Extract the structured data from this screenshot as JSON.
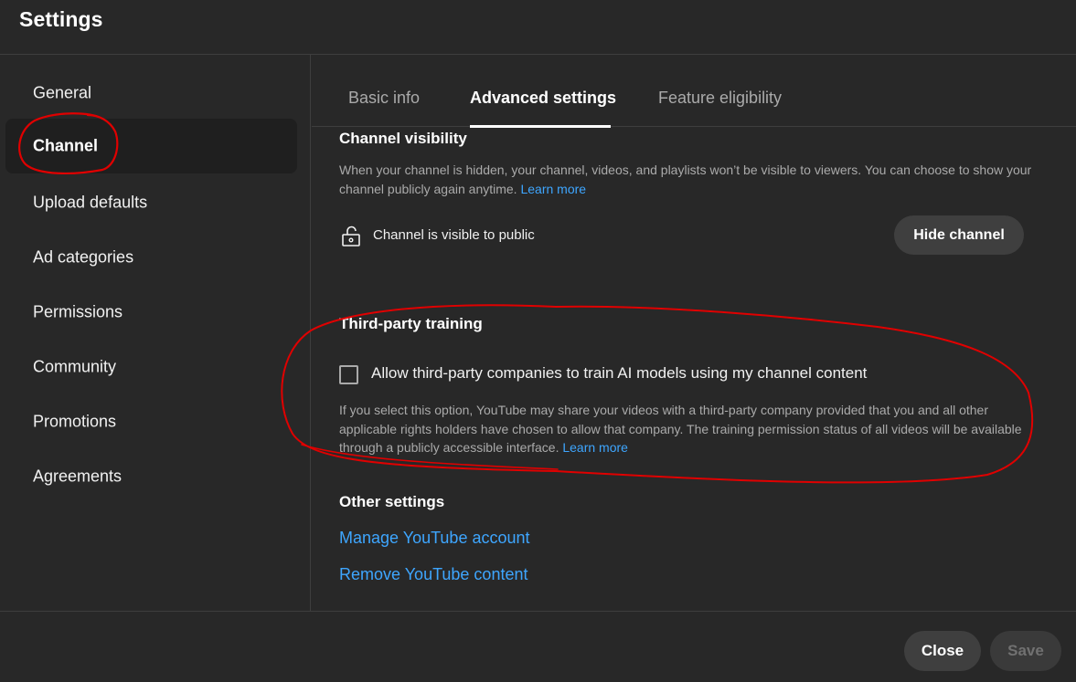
{
  "dialog": {
    "title": "Settings"
  },
  "sidebar": {
    "items": [
      {
        "label": "General",
        "active": false
      },
      {
        "label": "Channel",
        "active": true
      },
      {
        "label": "Upload defaults",
        "active": false
      },
      {
        "label": "Ad categories",
        "active": false
      },
      {
        "label": "Permissions",
        "active": false
      },
      {
        "label": "Community",
        "active": false
      },
      {
        "label": "Promotions",
        "active": false
      },
      {
        "label": "Agreements",
        "active": false
      }
    ]
  },
  "tabs": [
    {
      "label": "Basic info",
      "active": false
    },
    {
      "label": "Advanced settings",
      "active": true
    },
    {
      "label": "Feature eligibility",
      "active": false
    }
  ],
  "channel_visibility": {
    "title": "Channel visibility",
    "description": "When your channel is hidden, your channel, videos, and playlists won’t be visible to viewers. You can choose to show your channel publicly again anytime.",
    "learn_more": "Learn more",
    "status": "Channel is visible to public",
    "status_icon": "lock-open-icon",
    "hide_button": "Hide channel"
  },
  "third_party_training": {
    "title": "Third-party training",
    "checkbox_label": "Allow third-party companies to train AI models using my channel content",
    "checked": false,
    "description": "If you select this option, YouTube may share your videos with a third-party company provided that you and all other applicable rights holders have chosen to allow that company. The training permission status of all videos will be available through a publicly accessible interface.",
    "learn_more": "Learn more"
  },
  "other_settings": {
    "title": "Other settings",
    "links": [
      "Manage YouTube account",
      "Remove YouTube content"
    ]
  },
  "footer": {
    "close_label": "Close",
    "save_label": "Save",
    "save_enabled": false
  },
  "colors": {
    "background": "#282828",
    "link": "#3ea6ff",
    "annotation": "#e00000"
  }
}
